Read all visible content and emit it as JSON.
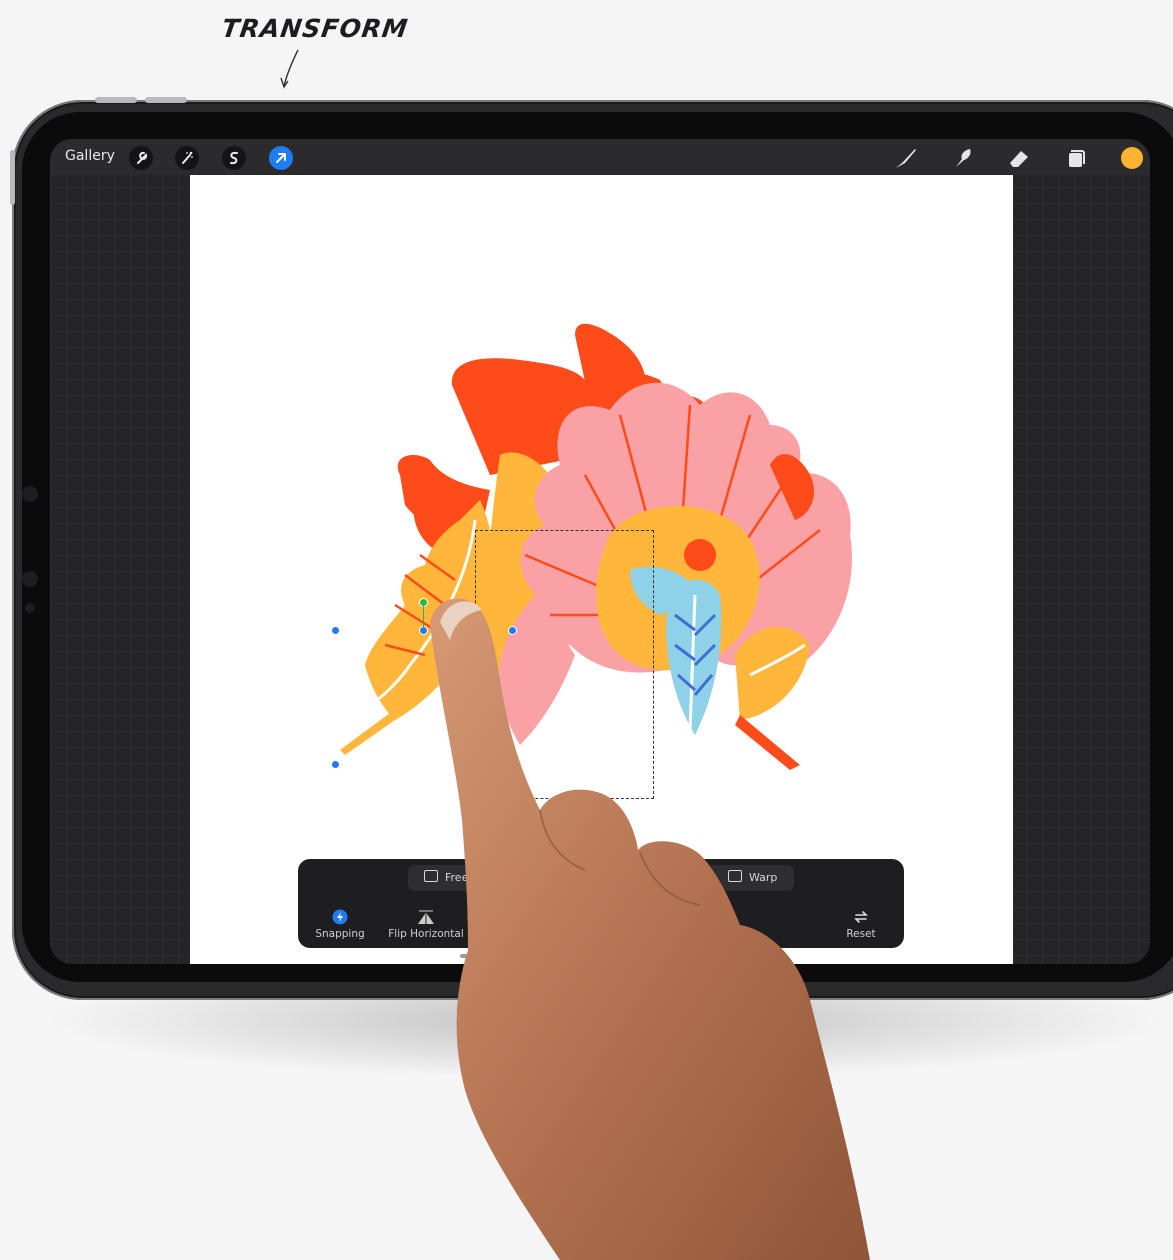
{
  "annotation": {
    "title": "TRANSFORM"
  },
  "toolbar_top": {
    "gallery_label": "Gallery",
    "left_icons": [
      "wrench-icon",
      "magic-wand-icon",
      "selection-icon",
      "transform-arrow-icon"
    ],
    "right_icons": [
      "brush-icon",
      "smudge-icon",
      "eraser-icon",
      "layers-icon"
    ],
    "active_tool": "transform-arrow-icon",
    "current_color": "#ffb32e"
  },
  "transform_toolbar": {
    "modes": [
      {
        "label": "Freeform"
      },
      {
        "label": "Warp"
      }
    ],
    "tools": [
      {
        "label": "Snapping",
        "icon": "lightning-icon",
        "active": true
      },
      {
        "label": "Flip Horizontal",
        "icon": "flip-horizontal-icon",
        "active": false
      },
      {
        "label": "Fl",
        "icon": "flip-vertical-icon",
        "active": false
      },
      {
        "label": "Reset",
        "icon": "reset-icon",
        "active": false
      }
    ]
  },
  "colors": {
    "accent": "#1f7cf5",
    "canvas": "#ffffff",
    "ui_dark": "#252528"
  }
}
